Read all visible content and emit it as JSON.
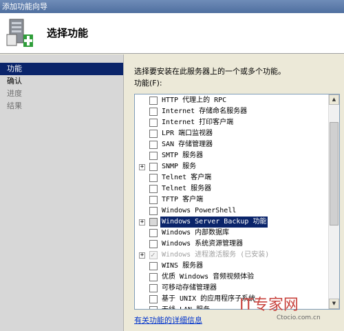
{
  "window": {
    "title": "添加功能向导"
  },
  "header": {
    "title": "选择功能",
    "icon": "server-add-icon"
  },
  "nav": [
    {
      "label": "功能",
      "state": "active"
    },
    {
      "label": "确认",
      "state": "normal"
    },
    {
      "label": "进度",
      "state": "dim"
    },
    {
      "label": "结果",
      "state": "dim"
    }
  ],
  "main": {
    "intro": "选择要安装在此服务器上的一个或多个功能。",
    "list_label": "功能(F):",
    "features": [
      {
        "label": "HTTP 代理上的 RPC",
        "expander": false,
        "checked": false,
        "state": "normal"
      },
      {
        "label": "Internet 存储命名服务器",
        "expander": false,
        "checked": false,
        "state": "normal"
      },
      {
        "label": "Internet 打印客户端",
        "expander": false,
        "checked": false,
        "state": "normal"
      },
      {
        "label": "LPR 端口监视器",
        "expander": false,
        "checked": false,
        "state": "normal"
      },
      {
        "label": "SAN 存储管理器",
        "expander": false,
        "checked": false,
        "state": "normal"
      },
      {
        "label": "SMTP 服务器",
        "expander": false,
        "checked": false,
        "state": "normal"
      },
      {
        "label": "SNMP 服务",
        "expander": true,
        "checked": false,
        "state": "normal"
      },
      {
        "label": "Telnet 客户端",
        "expander": false,
        "checked": false,
        "state": "normal"
      },
      {
        "label": "Telnet 服务器",
        "expander": false,
        "checked": false,
        "state": "normal"
      },
      {
        "label": "TFTP 客户端",
        "expander": false,
        "checked": false,
        "state": "normal"
      },
      {
        "label": "Windows PowerShell",
        "expander": false,
        "checked": false,
        "state": "normal"
      },
      {
        "label": "Windows Server Backup 功能",
        "expander": true,
        "checked": false,
        "state": "selected"
      },
      {
        "label": "Windows 内部数据库",
        "expander": false,
        "checked": false,
        "state": "normal"
      },
      {
        "label": "Windows 系统资源管理器",
        "expander": false,
        "checked": false,
        "state": "normal"
      },
      {
        "label": "Windows 进程激活服务  (已安装)",
        "expander": true,
        "checked": true,
        "state": "disabled"
      },
      {
        "label": "WINS 服务器",
        "expander": false,
        "checked": false,
        "state": "normal"
      },
      {
        "label": "优质 Windows 音频视频体验",
        "expander": false,
        "checked": false,
        "state": "normal"
      },
      {
        "label": "可移动存储管理器",
        "expander": false,
        "checked": false,
        "state": "normal"
      },
      {
        "label": "基于 UNIX 的应用程序子系统",
        "expander": false,
        "checked": false,
        "state": "normal"
      },
      {
        "label": "无线 LAN 服务",
        "expander": false,
        "checked": false,
        "state": "normal"
      }
    ],
    "help_link": "有关功能的详细信息"
  },
  "watermark": {
    "text": "IT专家网",
    "sub": "Ctocio.com.cn"
  },
  "colors": {
    "selection": "#0a246a",
    "link": "#0033cc",
    "watermark": "#c8433e"
  }
}
